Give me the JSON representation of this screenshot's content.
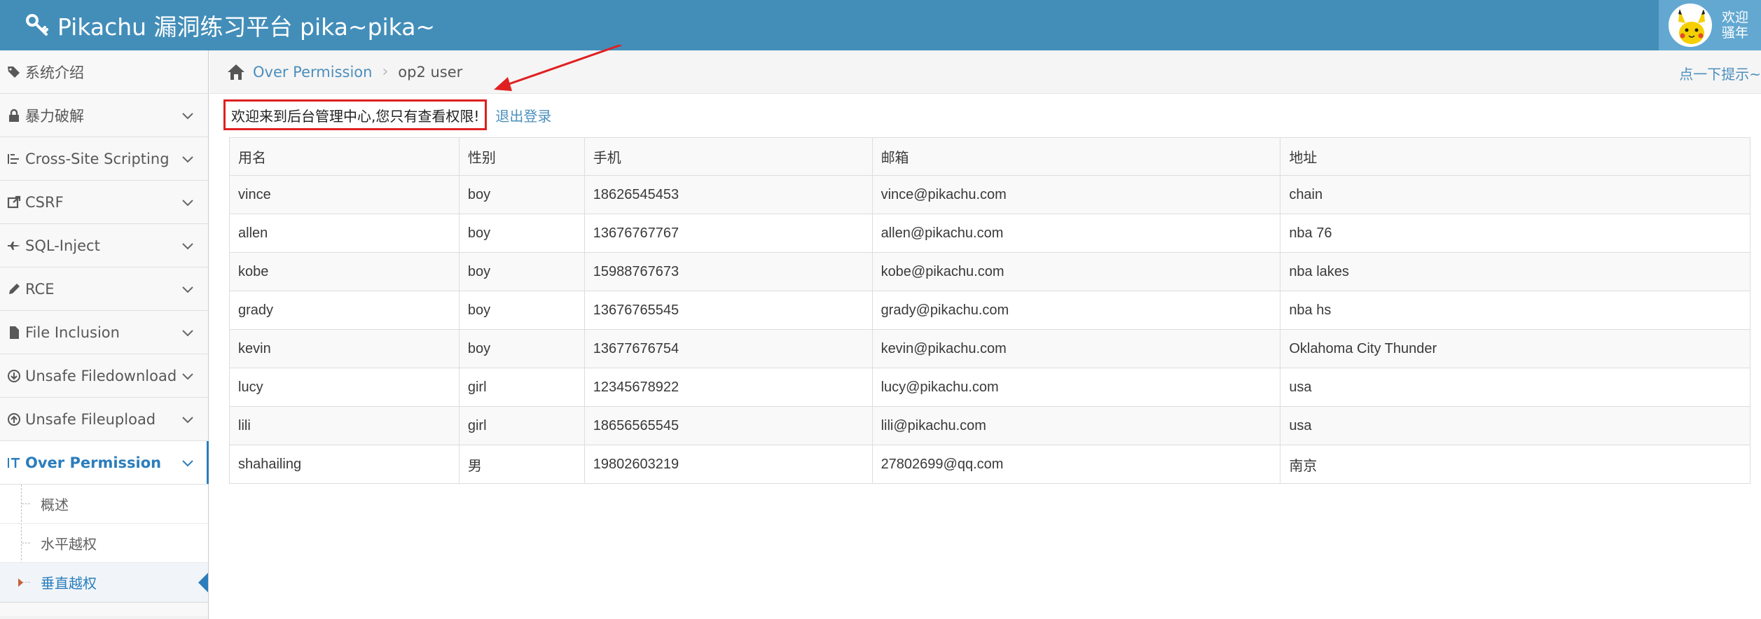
{
  "header": {
    "brand": "Pikachu 漏洞练习平台 pika~pika~",
    "welcome_line1": "欢迎",
    "welcome_line2": "骚年"
  },
  "sidebar": {
    "items": [
      {
        "label": "系统介绍",
        "icon": "tags-icon"
      },
      {
        "label": "暴力破解",
        "icon": "lock-icon"
      },
      {
        "label": "Cross-Site Scripting",
        "icon": "list-icon"
      },
      {
        "label": "CSRF",
        "icon": "share-icon"
      },
      {
        "label": "SQL-Inject",
        "icon": "fighter-jet-icon"
      },
      {
        "label": "RCE",
        "icon": "pencil-icon"
      },
      {
        "label": "File Inclusion",
        "icon": "file-icon"
      },
      {
        "label": "Unsafe Filedownload",
        "icon": "download-icon"
      },
      {
        "label": "Unsafe Fileupload",
        "icon": "upload-icon"
      },
      {
        "label": "Over Permission",
        "icon": "text-height-icon"
      }
    ],
    "sub_items": [
      "概述",
      "水平越权",
      "垂直越权"
    ]
  },
  "breadcrumb": {
    "parent": "Over Permission",
    "current": "op2 user",
    "hint": "点一下提示~"
  },
  "content": {
    "message": "欢迎来到后台管理中心,您只有查看权限!",
    "logout": "退出登录"
  },
  "table": {
    "headers": [
      "用名",
      "性别",
      "手机",
      "邮箱",
      "地址"
    ],
    "rows": [
      [
        "vince",
        "boy",
        "18626545453",
        "vince@pikachu.com",
        "chain"
      ],
      [
        "allen",
        "boy",
        "13676767767",
        "allen@pikachu.com",
        "nba 76"
      ],
      [
        "kobe",
        "boy",
        "15988767673",
        "kobe@pikachu.com",
        "nba lakes"
      ],
      [
        "grady",
        "boy",
        "13676765545",
        "grady@pikachu.com",
        "nba hs"
      ],
      [
        "kevin",
        "boy",
        "13677676754",
        "kevin@pikachu.com",
        "Oklahoma City Thunder"
      ],
      [
        "lucy",
        "girl",
        "12345678922",
        "lucy@pikachu.com",
        "usa"
      ],
      [
        "lili",
        "girl",
        "18656565545",
        "lili@pikachu.com",
        "usa"
      ],
      [
        "shahailing",
        "男",
        "19802603219",
        "27802699@qq.com",
        "南京"
      ]
    ]
  },
  "colors": {
    "navbar": "#438eb9",
    "accent": "#2b7dbc",
    "highlight_border": "#e02020"
  }
}
